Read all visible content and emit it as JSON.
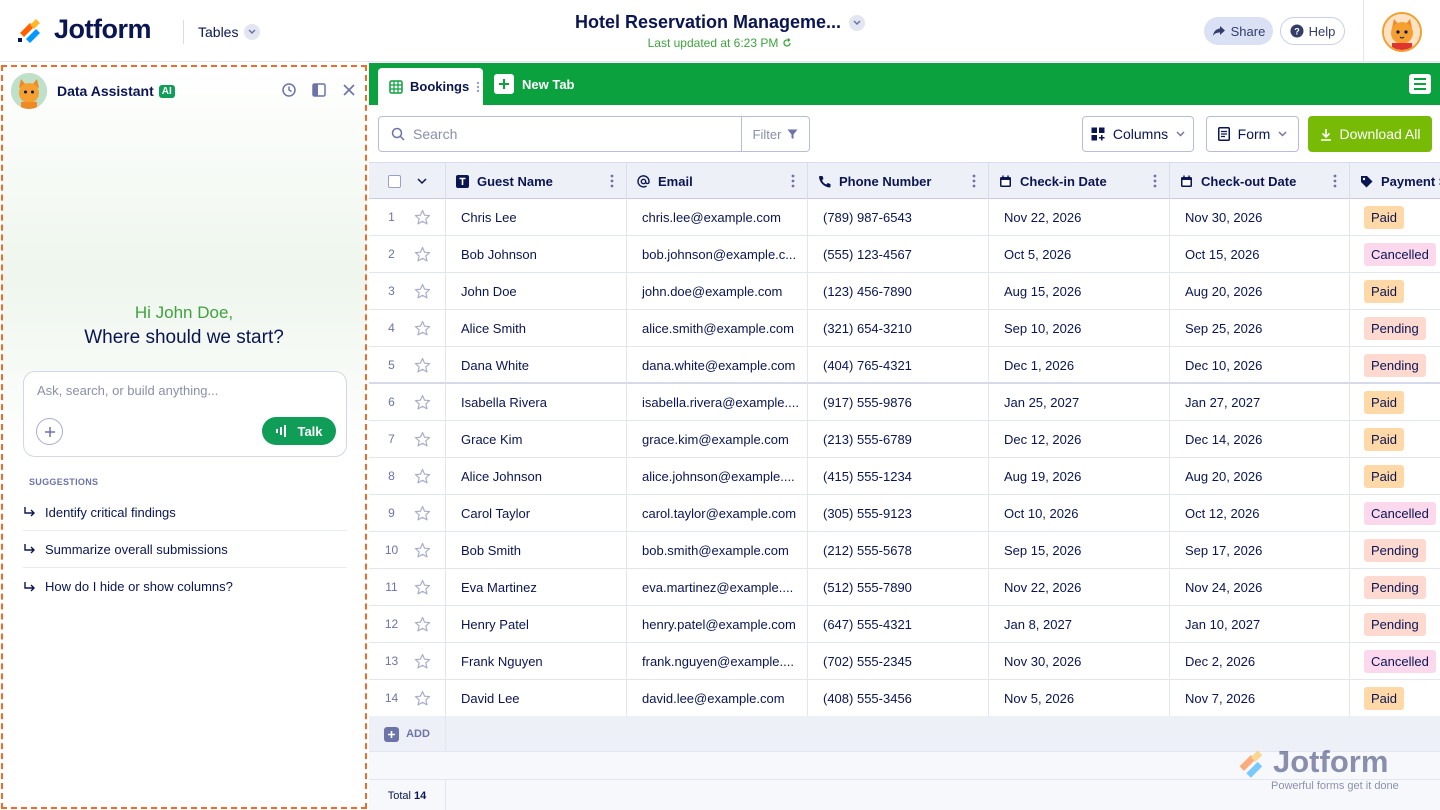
{
  "app": {
    "logo_text": "Jotform",
    "tables_label": "Tables"
  },
  "header": {
    "title": "Hotel Reservation Manageme...",
    "updated": "Last updated at 6:23 PM",
    "share_label": "Share",
    "help_label": "Help"
  },
  "assistant": {
    "title": "Data Assistant",
    "ai_badge": "AI",
    "greeting": "Hi John Doe,",
    "prompt": "Where should we start?",
    "input_placeholder": "Ask, search, or build anything...",
    "talk_label": "Talk",
    "suggestions_label": "SUGGESTIONS",
    "suggestions": [
      "Identify critical findings",
      "Summarize overall submissions",
      "How do I hide or show columns?"
    ]
  },
  "tabs": {
    "active": "Bookings",
    "new_tab": "New Tab"
  },
  "toolbar": {
    "search_placeholder": "Search",
    "filter_label": "Filter",
    "columns_label": "Columns",
    "form_label": "Form",
    "download_label": "Download All"
  },
  "table": {
    "columns": [
      "Guest Name",
      "Email",
      "Phone Number",
      "Check-in Date",
      "Check-out Date",
      "Payment S"
    ],
    "rows": [
      {
        "n": "1",
        "name": "Chris Lee",
        "email": "chris.lee@example.com",
        "phone": "(789) 987-6543",
        "checkin": "Nov 22, 2026",
        "checkout": "Nov 30, 2026",
        "payment": "Paid"
      },
      {
        "n": "2",
        "name": "Bob Johnson",
        "email": "bob.johnson@example.c...",
        "phone": "(555) 123-4567",
        "checkin": "Oct 5, 2026",
        "checkout": "Oct 15, 2026",
        "payment": "Cancelled"
      },
      {
        "n": "3",
        "name": "John Doe",
        "email": "john.doe@example.com",
        "phone": "(123) 456-7890",
        "checkin": "Aug 15, 2026",
        "checkout": "Aug 20, 2026",
        "payment": "Paid"
      },
      {
        "n": "4",
        "name": "Alice Smith",
        "email": "alice.smith@example.com",
        "phone": "(321) 654-3210",
        "checkin": "Sep 10, 2026",
        "checkout": "Sep 25, 2026",
        "payment": "Pending"
      },
      {
        "n": "5",
        "name": "Dana White",
        "email": "dana.white@example.com",
        "phone": "(404) 765-4321",
        "checkin": "Dec 1, 2026",
        "checkout": "Dec 10, 2026",
        "payment": "Pending"
      },
      {
        "n": "6",
        "name": "Isabella Rivera",
        "email": "isabella.rivera@example....",
        "phone": "(917) 555-9876",
        "checkin": "Jan 25, 2027",
        "checkout": "Jan 27, 2027",
        "payment": "Paid"
      },
      {
        "n": "7",
        "name": "Grace Kim",
        "email": "grace.kim@example.com",
        "phone": "(213) 555-6789",
        "checkin": "Dec 12, 2026",
        "checkout": "Dec 14, 2026",
        "payment": "Paid"
      },
      {
        "n": "8",
        "name": "Alice Johnson",
        "email": "alice.johnson@example....",
        "phone": "(415) 555-1234",
        "checkin": "Aug 19, 2026",
        "checkout": "Aug 20, 2026",
        "payment": "Paid"
      },
      {
        "n": "9",
        "name": "Carol Taylor",
        "email": "carol.taylor@example.com",
        "phone": "(305) 555-9123",
        "checkin": "Oct 10, 2026",
        "checkout": "Oct 12, 2026",
        "payment": "Cancelled"
      },
      {
        "n": "10",
        "name": "Bob Smith",
        "email": "bob.smith@example.com",
        "phone": "(212) 555-5678",
        "checkin": "Sep 15, 2026",
        "checkout": "Sep 17, 2026",
        "payment": "Pending"
      },
      {
        "n": "11",
        "name": "Eva Martinez",
        "email": "eva.martinez@example....",
        "phone": "(512) 555-7890",
        "checkin": "Nov 22, 2026",
        "checkout": "Nov 24, 2026",
        "payment": "Pending"
      },
      {
        "n": "12",
        "name": "Henry Patel",
        "email": "henry.patel@example.com",
        "phone": "(647) 555-4321",
        "checkin": "Jan 8, 2027",
        "checkout": "Jan 10, 2027",
        "payment": "Pending"
      },
      {
        "n": "13",
        "name": "Frank Nguyen",
        "email": "frank.nguyen@example....",
        "phone": "(702) 555-2345",
        "checkin": "Nov 30, 2026",
        "checkout": "Dec 2, 2026",
        "payment": "Cancelled"
      },
      {
        "n": "14",
        "name": "David Lee",
        "email": "david.lee@example.com",
        "phone": "(408) 555-3456",
        "checkin": "Nov 5, 2026",
        "checkout": "Nov 7, 2026",
        "payment": "Paid"
      }
    ],
    "add_label": "ADD",
    "total_label": "Total",
    "total_count": "14"
  },
  "status_colors": {
    "Paid": "#ffd8a8",
    "Cancelled": "#fbd8ec",
    "Pending": "#fdd9d0"
  },
  "watermark": {
    "word": "Jotform",
    "tagline": "Powerful forms get it done"
  },
  "colors": {
    "brand_green": "#0ba13f",
    "download_green": "#78bb07",
    "navy": "#0a1551",
    "accent_orange": "#ef6b2c"
  }
}
